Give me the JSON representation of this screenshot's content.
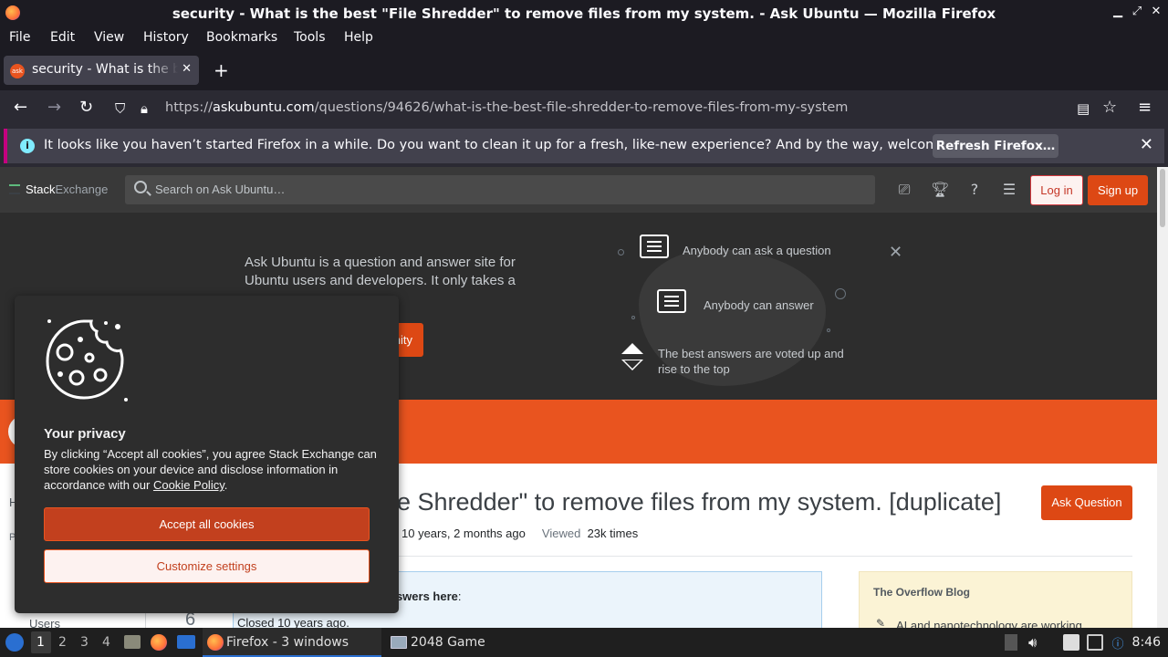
{
  "window": {
    "title": "security - What is the best \"File Shredder\" to remove files from my system. - Ask Ubuntu — Mozilla Firefox"
  },
  "menu": [
    "File",
    "Edit",
    "View",
    "History",
    "Bookmarks",
    "Tools",
    "Help"
  ],
  "tab": {
    "label": "security - What is the best \"File Shredder\" to remove files from my system. - Ask Ubuntu",
    "favicon_text": "ask"
  },
  "url": {
    "prefix": "https://",
    "domain": "askubuntu.com",
    "path": "/questions/94626/what-is-the-best-file-shredder-to-remove-files-from-my-system"
  },
  "notification": {
    "message": "It looks like you haven’t started Firefox in a while. Do you want to clean it up for a fresh, like-new experience? And by the way, welcome back!",
    "button": "Refresh Firefox…"
  },
  "stackexchange": {
    "logo_a": "Stack",
    "logo_b": "Exchange",
    "search_placeholder": "Search on Ask Ubuntu…",
    "login": "Log in",
    "signup": "Sign up"
  },
  "hero": {
    "intro": "Ask Ubuntu is a question and answer site for Ubuntu users and developers. It only takes a",
    "join_partial": "nity",
    "feature1": "Anybody can ask a question",
    "feature2": "Anybody can answer",
    "feature3": "The best answers are voted up and rise to the top"
  },
  "question": {
    "title_visible": "e Shredder\" to remove files from my system. [duplicate]",
    "ask_button": "Ask Question",
    "asked_value": "10 years, 2 months ago",
    "viewed_label": "Viewed",
    "viewed_value": "23k times",
    "dup_text": "nswers here",
    "dup_colon": ":",
    "closed": "Closed 10 years ago.",
    "votes": "6"
  },
  "leftnav": {
    "h": "H",
    "p": "P",
    "users": "Users"
  },
  "blog": {
    "title": "The Overflow Blog",
    "item": "AI and nanotechnology are working"
  },
  "cookie": {
    "title": "Your privacy",
    "text_before": "By clicking “Accept all cookies”, you agree Stack Exchange can store cookies on your device and disclose information in accordance with our ",
    "link": "Cookie Policy",
    "text_after": ".",
    "accept": "Accept all cookies",
    "customize": "Customize settings"
  },
  "taskbar": {
    "workspaces": [
      "1",
      "2",
      "3",
      "4"
    ],
    "task1": "Firefox - 3 windows",
    "task2": "2048 Game",
    "time": "8:46"
  }
}
